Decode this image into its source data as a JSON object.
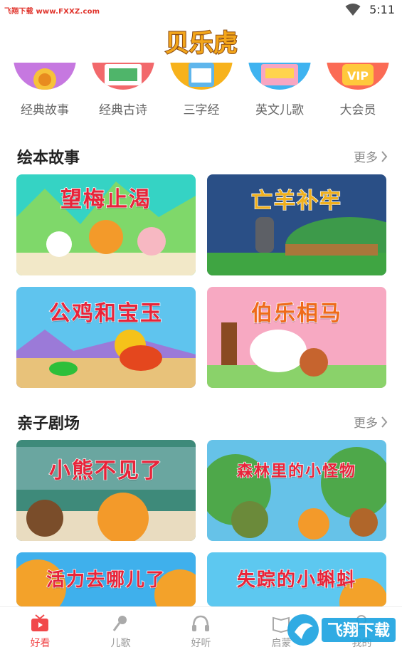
{
  "status_bar": {
    "watermark": "飞翔下载 www.FXXZ.com",
    "time": "5:11"
  },
  "app": {
    "logo_text": "贝乐虎"
  },
  "categories": [
    {
      "label": "经典故事",
      "color": "#c678e0"
    },
    {
      "label": "经典古诗",
      "color": "#f2696c"
    },
    {
      "label": "三字经",
      "color": "#f7b21c"
    },
    {
      "label": "英文儿歌",
      "color": "#3fb3f0"
    },
    {
      "label": "大会员",
      "color": "#fb6b55"
    }
  ],
  "sections": [
    {
      "title": "绘本故事",
      "more": "更多",
      "cards": [
        {
          "title": "望梅止渴",
          "title_color": "#e8243a"
        },
        {
          "title": "亡羊补牢",
          "title_color": "#f0b01d"
        },
        {
          "title": "公鸡和宝玉",
          "title_color": "#e8243a"
        },
        {
          "title": "伯乐相马",
          "title_color": "#f06a1a"
        }
      ]
    },
    {
      "title": "亲子剧场",
      "more": "更多",
      "cards": [
        {
          "title": "小熊不见了",
          "title_color": "#e8243a"
        },
        {
          "title": "森林里的小怪物",
          "title_color": "#e8243a"
        },
        {
          "title": "活力去哪儿了",
          "title_color": "#e8243a"
        },
        {
          "title": "失踪的小蝌蚪",
          "title_color": "#e8243a"
        }
      ]
    }
  ],
  "tabs": [
    {
      "label": "好看",
      "icon": "tv-icon",
      "active": true
    },
    {
      "label": "儿歌",
      "icon": "microphone-icon",
      "active": false
    },
    {
      "label": "好听",
      "icon": "headphones-icon",
      "active": false
    },
    {
      "label": "启蒙",
      "icon": "book-icon",
      "active": false
    },
    {
      "label": "我的",
      "icon": "user-icon",
      "active": false
    }
  ],
  "brand_watermark": "飞翔下载"
}
